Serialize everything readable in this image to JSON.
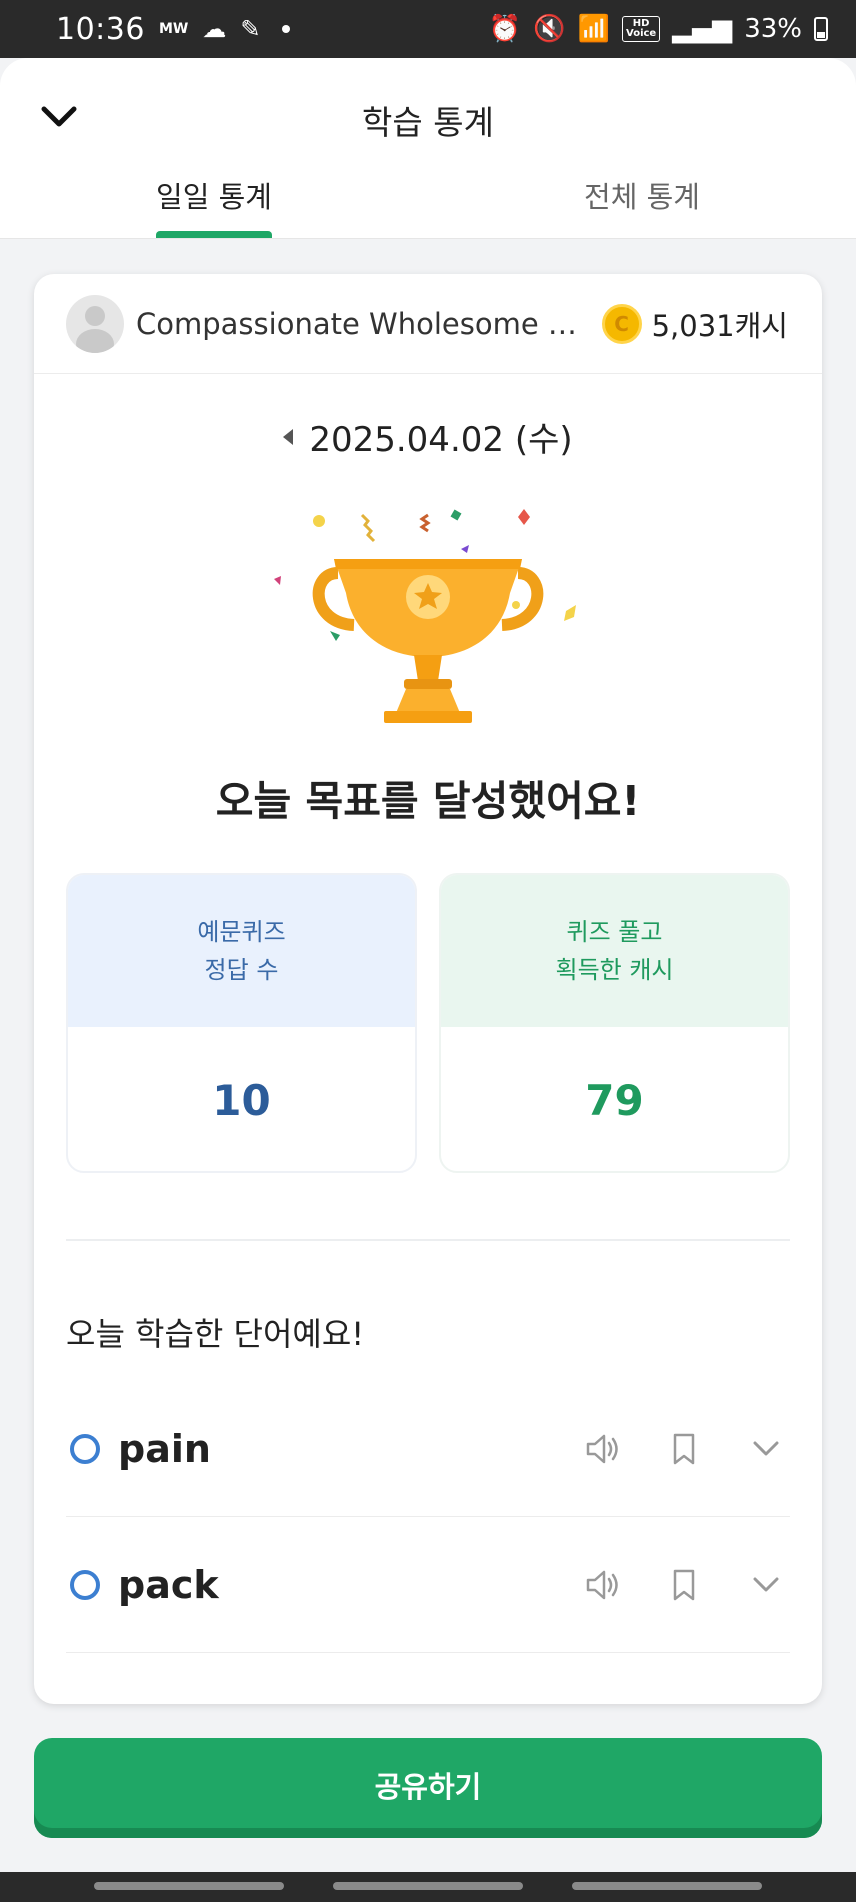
{
  "status_bar": {
    "time": "10:36",
    "carrier_tag": "MW",
    "battery": "33%",
    "hd_line1": "HD",
    "hd_line2": "Voice"
  },
  "header": {
    "title": "학습 통계",
    "tabs": [
      {
        "label": "일일 통계",
        "active": true
      },
      {
        "label": "전체 통계",
        "active": false
      }
    ]
  },
  "card": {
    "user_name": "Compassionate Wholesome Re...",
    "coin_symbol": "C",
    "cash": "5,031캐시",
    "date": "2025.04.02 (수)",
    "goal_message": "오늘 목표를 달성했어요!",
    "stats": [
      {
        "label_line1": "예문퀴즈",
        "label_line2": "정답 수",
        "value": "10"
      },
      {
        "label_line1": "퀴즈 풀고",
        "label_line2": "획득한 캐시",
        "value": "79"
      }
    ],
    "words_title": "오늘 학습한 단어예요!",
    "words": [
      {
        "word": "pain"
      },
      {
        "word": "pack"
      }
    ]
  },
  "share_button": "공유하기",
  "colors": {
    "accent_green": "#1fa766",
    "stat_blue": "#2c5c99",
    "stat_green": "#1f9a5e",
    "circle_blue": "#3c7fd1"
  }
}
